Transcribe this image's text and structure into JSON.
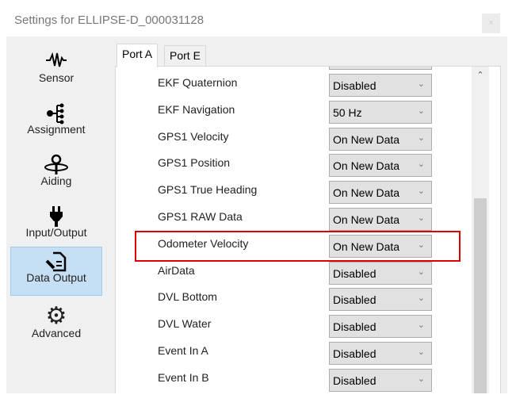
{
  "window": {
    "title": "Settings for ELLIPSE-D_000031128",
    "close": "×"
  },
  "sidebar": {
    "items": [
      {
        "label": "Sensor",
        "icon": "waveform-icon"
      },
      {
        "label": "Assignment",
        "icon": "tree-icon"
      },
      {
        "label": "Aiding",
        "icon": "location-pin-icon"
      },
      {
        "label": "Input/Output",
        "icon": "plug-icon"
      },
      {
        "label": "Data Output",
        "icon": "document-pen-icon",
        "selected": true
      },
      {
        "label": "Advanced",
        "icon": "gear-icon"
      }
    ]
  },
  "tabs": [
    {
      "label": "Port A",
      "active": true
    },
    {
      "label": "Port E"
    }
  ],
  "rows": [
    {
      "label": "EKF Quaternion",
      "value": "Disabled"
    },
    {
      "label": "EKF Navigation",
      "value": "50 Hz"
    },
    {
      "label": "GPS1 Velocity",
      "value": "On New Data"
    },
    {
      "label": "GPS1 Position",
      "value": "On New Data"
    },
    {
      "label": "GPS1 True Heading",
      "value": "On New Data"
    },
    {
      "label": "GPS1 RAW Data",
      "value": "On New Data"
    },
    {
      "label": "Odometer Velocity",
      "value": "On New Data",
      "highlighted": true
    },
    {
      "label": "AirData",
      "value": "Disabled"
    },
    {
      "label": "DVL Bottom",
      "value": "Disabled"
    },
    {
      "label": "DVL Water",
      "value": "Disabled"
    },
    {
      "label": "Event In A",
      "value": "Disabled"
    },
    {
      "label": "Event In B",
      "value": "Disabled"
    }
  ],
  "colors": {
    "highlight": "#e00000",
    "selected_nav": "#c5dff5"
  }
}
